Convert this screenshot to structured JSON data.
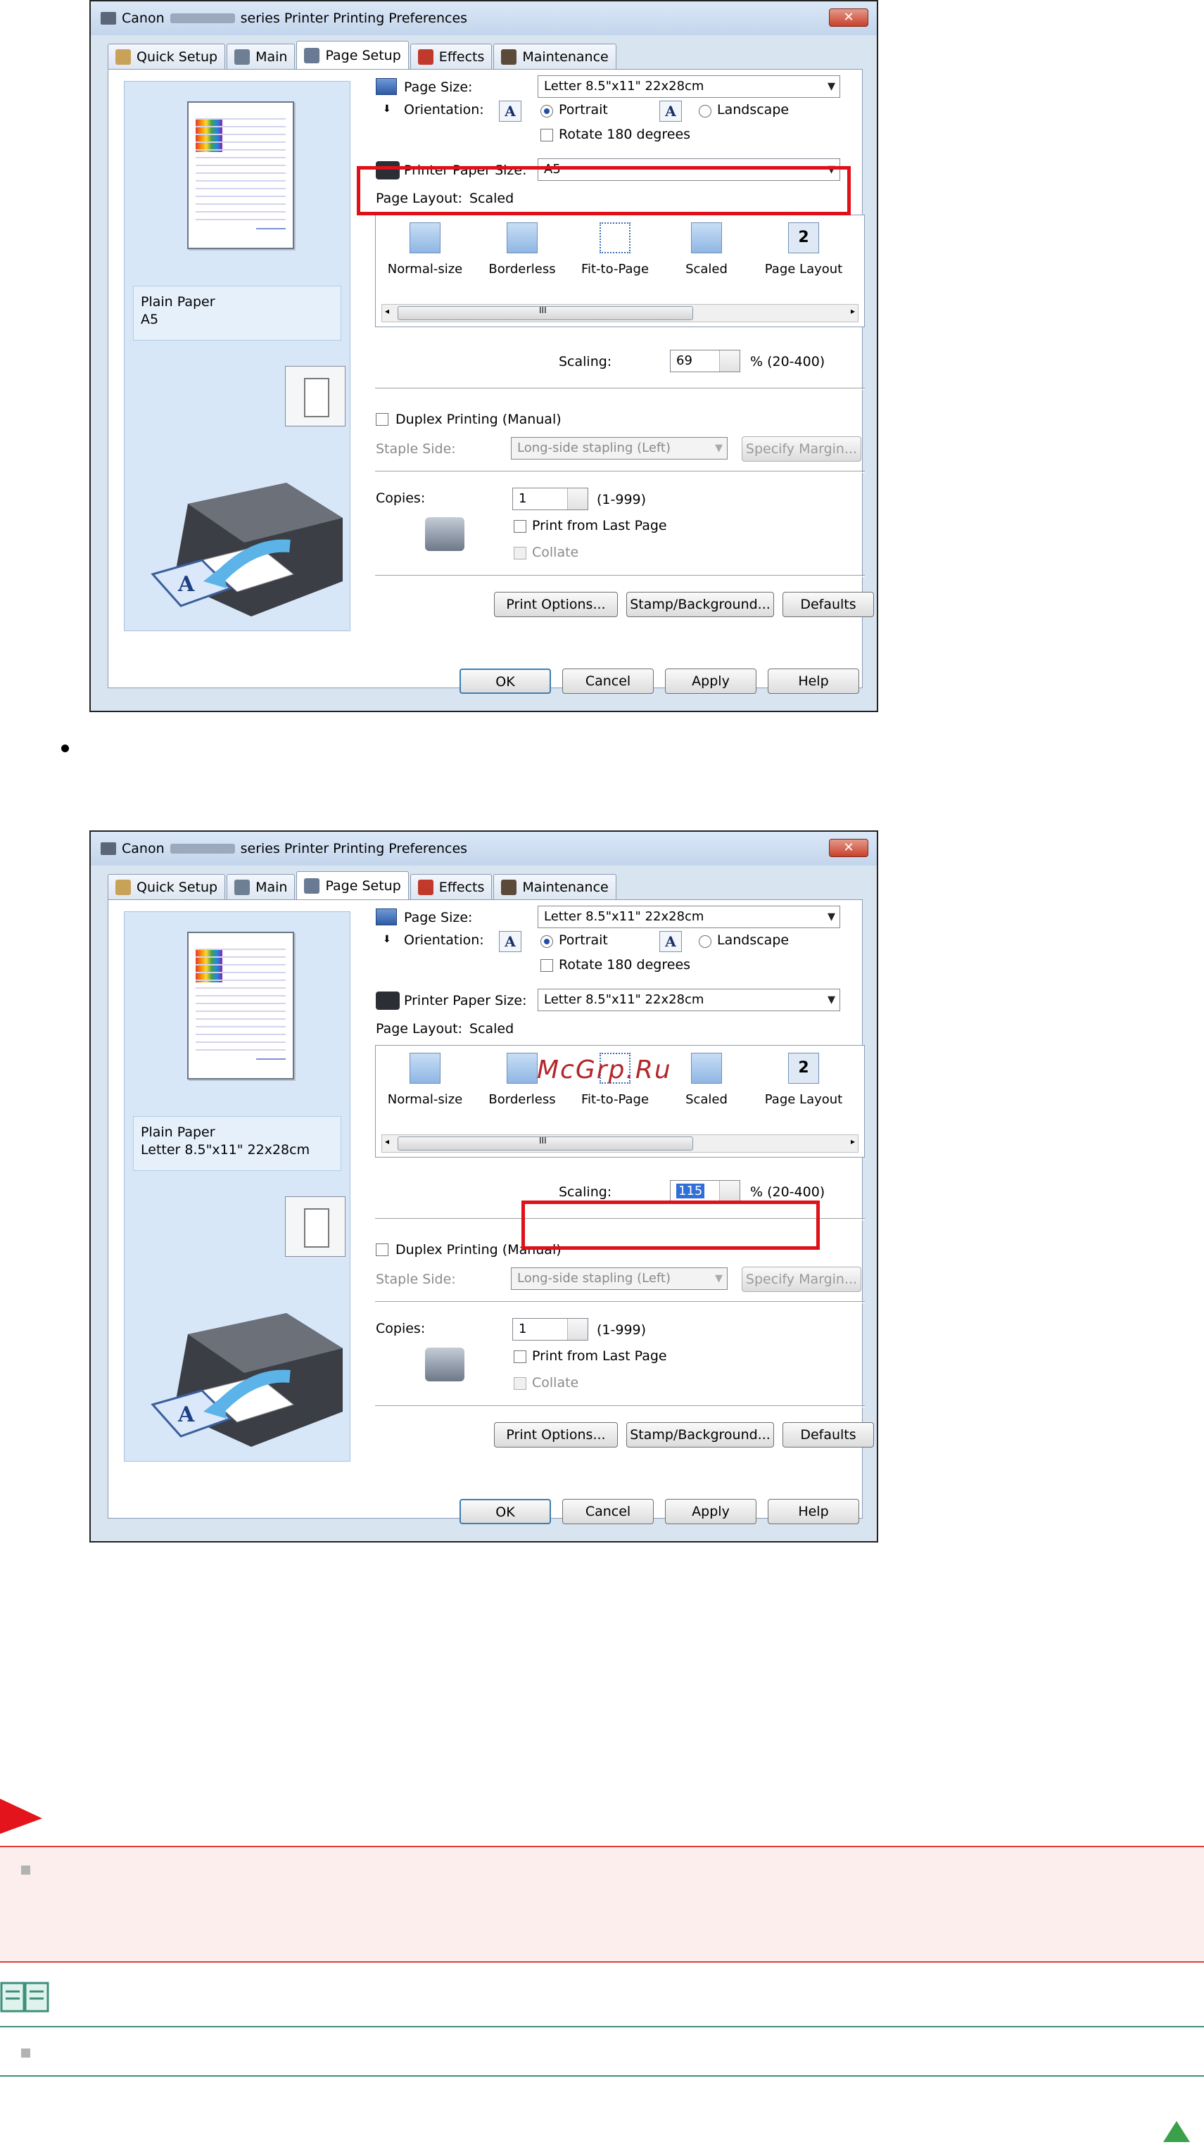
{
  "dialogs": [
    {
      "title_prefix": "Canon",
      "title_suffix": "series Printer Printing Preferences",
      "close": "✕",
      "tabs": [
        "Quick Setup",
        "Main",
        "Page Setup",
        "Effects",
        "Maintenance"
      ],
      "page_size_label": "Page Size:",
      "page_size_value": "Letter 8.5\"x11\" 22x28cm",
      "orientation_label": "Orientation:",
      "portrait": "Portrait",
      "landscape": "Landscape",
      "rotate": "Rotate 180 degrees",
      "printer_paper_size_label": "Printer Paper Size:",
      "printer_paper_size_value": "A5",
      "page_layout_label": "Page Layout:",
      "page_layout_value": "Scaled",
      "layouts": [
        "Normal-size",
        "Borderless",
        "Fit-to-Page",
        "Scaled",
        "Page Layout"
      ],
      "scroll_mark": "III",
      "scaling_label": "Scaling:",
      "scaling_value": "69",
      "scaling_range": "% (20-400)",
      "duplex": "Duplex Printing (Manual)",
      "staple_label": "Staple Side:",
      "staple_value": "Long-side stapling (Left)",
      "specify_margin": "Specify Margin...",
      "copies_label": "Copies:",
      "copies_value": "1",
      "copies_range": "(1-999)",
      "print_last": "Print from Last Page",
      "collate": "Collate",
      "print_options": "Print Options...",
      "stamp": "Stamp/Background...",
      "defaults": "Defaults",
      "ok": "OK",
      "cancel": "Cancel",
      "apply": "Apply",
      "help": "Help",
      "paper_type": "Plain Paper",
      "paper_size": "A5"
    },
    {
      "title_prefix": "Canon",
      "title_suffix": "series Printer Printing Preferences",
      "close": "✕",
      "tabs": [
        "Quick Setup",
        "Main",
        "Page Setup",
        "Effects",
        "Maintenance"
      ],
      "page_size_label": "Page Size:",
      "page_size_value": "Letter 8.5\"x11\" 22x28cm",
      "orientation_label": "Orientation:",
      "portrait": "Portrait",
      "landscape": "Landscape",
      "rotate": "Rotate 180 degrees",
      "printer_paper_size_label": "Printer Paper Size:",
      "printer_paper_size_value": "Letter 8.5\"x11\" 22x28cm",
      "page_layout_label": "Page Layout:",
      "page_layout_value": "Scaled",
      "layouts": [
        "Normal-size",
        "Borderless",
        "Fit-to-Page",
        "Scaled",
        "Page Layout"
      ],
      "scroll_mark": "III",
      "scaling_label": "Scaling:",
      "scaling_value": "115",
      "scaling_range": "% (20-400)",
      "duplex": "Duplex Printing (Manual)",
      "staple_label": "Staple Side:",
      "staple_value": "Long-side stapling (Left)",
      "specify_margin": "Specify Margin...",
      "copies_label": "Copies:",
      "copies_value": "1",
      "copies_range": "(1-999)",
      "print_last": "Print from Last Page",
      "collate": "Collate",
      "print_options": "Print Options...",
      "stamp": "Stamp/Background...",
      "defaults": "Defaults",
      "ok": "OK",
      "cancel": "Cancel",
      "apply": "Apply",
      "help": "Help",
      "paper_type": "Plain Paper",
      "paper_size": "Letter 8.5\"x11\" 22x28cm"
    }
  ],
  "watermark": "McGrp.Ru",
  "icons": {
    "flag": "flag-icon",
    "note": "book-icon",
    "top": "arrow-up-icon"
  },
  "colors": {
    "highlight": "#e01019",
    "warning_bg": "#fdeeee",
    "warning_line": "#e23b3b",
    "note_line": "#3e8f7c"
  }
}
